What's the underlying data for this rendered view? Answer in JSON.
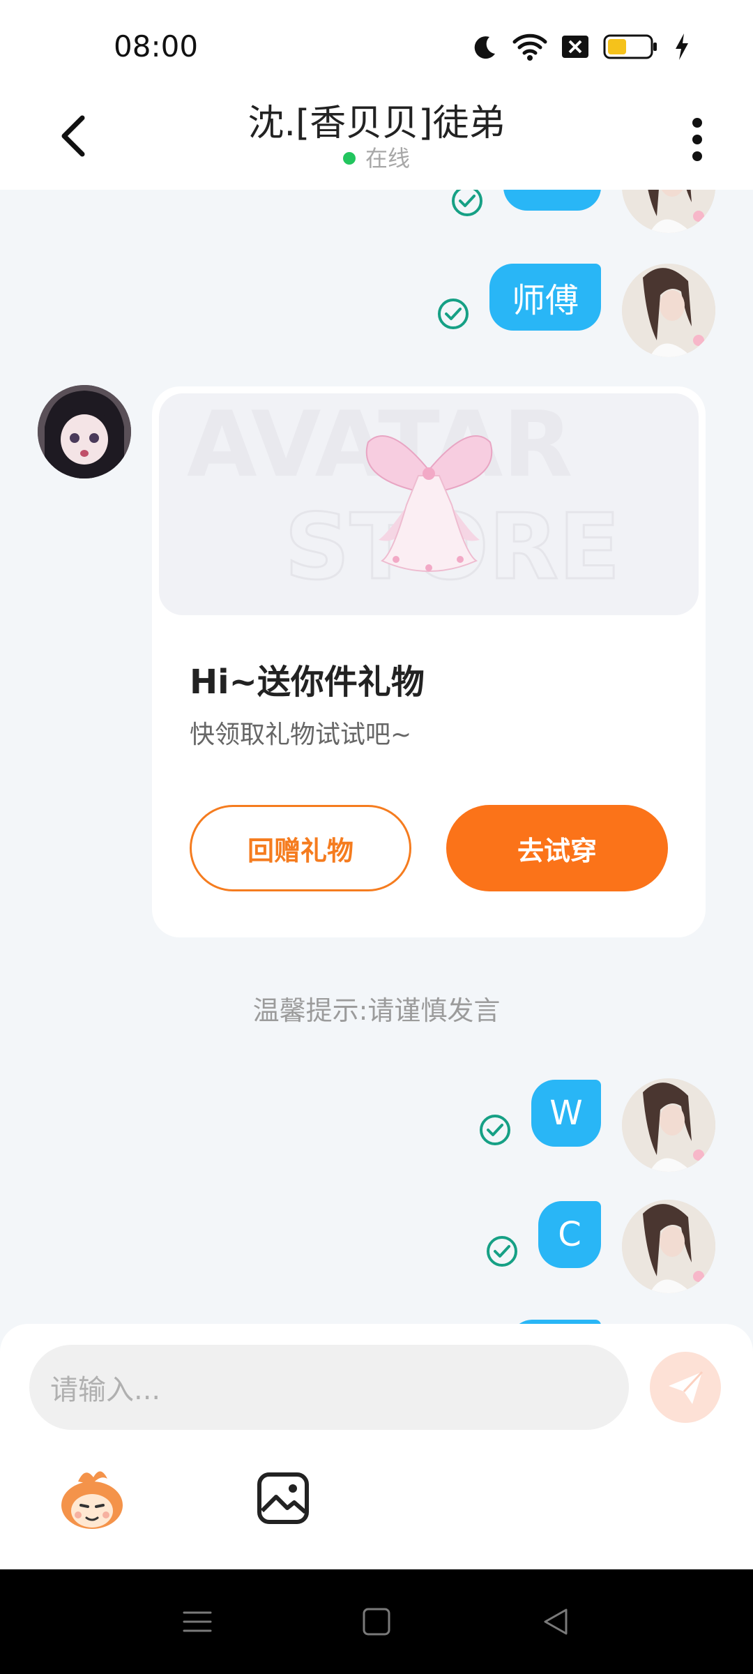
{
  "status_bar": {
    "time": "08:00"
  },
  "header": {
    "title": "沈.[香贝贝]徒弟",
    "status": "在线"
  },
  "messages": [
    {
      "from": "me",
      "text": "师傅"
    },
    {
      "from": "me",
      "text": "W"
    },
    {
      "from": "me",
      "text": "C"
    }
  ],
  "gift_card": {
    "watermark_line1": "AVATAR",
    "watermark_line2": "STORE",
    "title": "Hi~送你件礼物",
    "description": "快领取礼物试试吧~",
    "return_gift_label": "回赠礼物",
    "try_on_label": "去试穿"
  },
  "tip": "温馨提示:请谨慎发言",
  "input": {
    "placeholder": "请输入..."
  },
  "colors": {
    "bubble": "#29b6f6",
    "accent_orange": "#fb7319",
    "check_green": "#16a085",
    "online_green": "#22c55e"
  }
}
